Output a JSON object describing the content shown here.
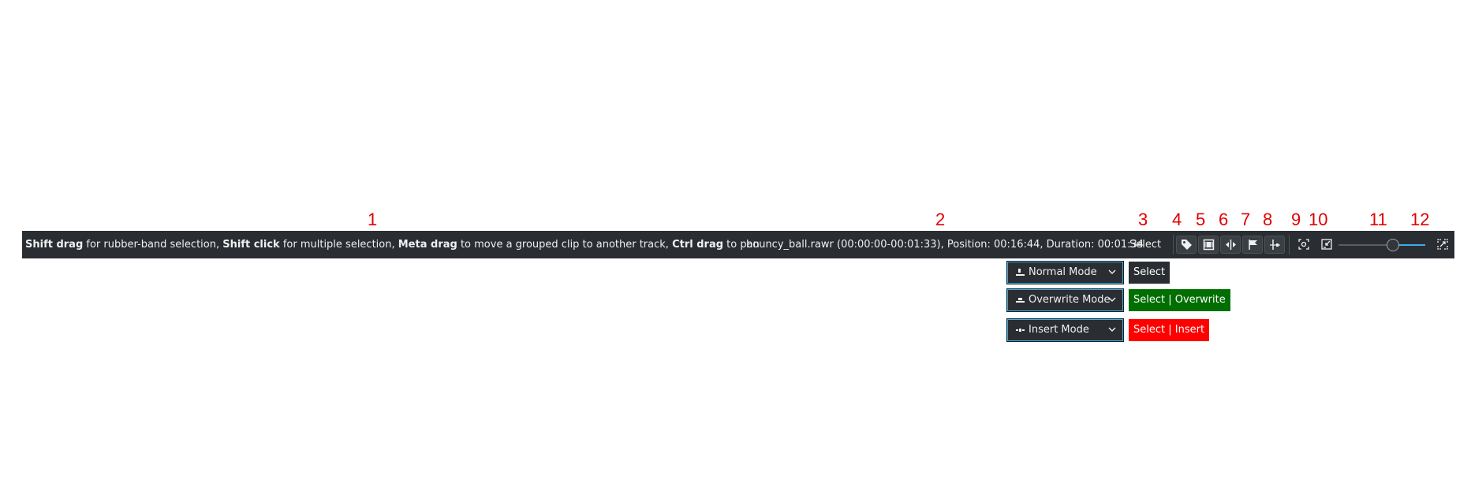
{
  "callouts": [
    "1",
    "2",
    "3",
    "4",
    "5",
    "6",
    "7",
    "8",
    "9",
    "10",
    "11",
    "12"
  ],
  "statusbar": {
    "hint": {
      "k1": "Shift drag",
      "t1": " for rubber-band selection, ",
      "k2": "Shift click",
      "t2": " for multiple selection, ",
      "k3": "Meta drag",
      "t3": " to move a grouped clip to another track, ",
      "k4": "Ctrl drag",
      "t4": " to pan"
    },
    "clip_info": "bouncy_ball.rawr (00:00:00-00:01:33), Position: 00:16:44, Duration: 00:01:34",
    "tool_mode": "Select",
    "zoom_fraction": 0.65
  },
  "icons": {
    "tag": "tag-icon",
    "film": "film-icon",
    "snap": "snap-icon",
    "flag": "flag-icon",
    "marker": "marker-icon",
    "zoom_fit": "zoom-fit-icon",
    "zoom_collapse": "collapse-icon",
    "fullscreen": "fullscreen-icon"
  },
  "modes": [
    {
      "label": "Normal Mode",
      "badge": "Select",
      "badge_color": "#2a2e32"
    },
    {
      "label": "Overwrite Mode",
      "badge": "Select | Overwrite",
      "badge_color": "#006e00"
    },
    {
      "label": "Insert Mode",
      "badge": "Select | Insert",
      "badge_color": "#ff0000"
    }
  ],
  "colors": {
    "bar_bg": "#2a2e32",
    "accent": "#3daee9",
    "callout": "#e00000"
  }
}
